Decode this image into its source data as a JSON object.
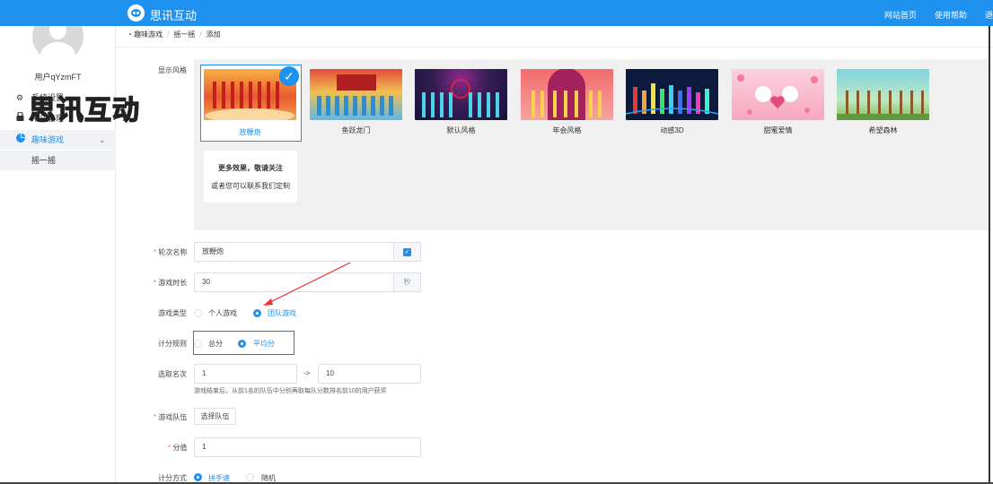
{
  "header": {
    "brand": "思讯互动",
    "nav": [
      "网站首页",
      "使用帮助",
      "退"
    ]
  },
  "sidebar": {
    "username": "用户qYzmFT",
    "items": [
      {
        "icon": "gear-icon",
        "label": "系统设置"
      },
      {
        "icon": "lock-icon",
        "label": "用户管理"
      },
      {
        "icon": "pie-chart-icon",
        "label": "趣味游戏"
      }
    ],
    "sub_items": [
      "摇一摇"
    ],
    "watermark": "思讯互动"
  },
  "breadcrumb": [
    "趣味游戏",
    "摇一摇",
    "添加"
  ],
  "form": {
    "style_label": "显示风格",
    "styles": [
      "放鞭炮",
      "鱼跃龙门",
      "默认风格",
      "年会风格",
      "动感3D",
      "甜蜜爱情",
      "希望森林"
    ],
    "selected_style": "放鞭炮",
    "more_title": "更多效果，敬请关注",
    "more_sub": "或者您可以联系我们定制",
    "round_name": {
      "label": "轮次名称",
      "value": "放鞭炮"
    },
    "duration": {
      "label": "游戏时长",
      "value": "30",
      "unit": "秒"
    },
    "game_type": {
      "label": "游戏类型",
      "options": [
        "个人游戏",
        "团队游戏"
      ],
      "selected": "团队游戏"
    },
    "score_rule": {
      "label": "计分规则",
      "options": [
        "总分",
        "平均分"
      ],
      "selected": "平均分"
    },
    "ranking": {
      "label": "选取名次",
      "from": "1",
      "arrow": "->",
      "to": "10",
      "hint": "游戏结束后，从前1名的队伍中分别再取每队分数排名前10的用户获奖"
    },
    "team": {
      "label": "游戏队伍",
      "button": "选择队伍"
    },
    "score_value": {
      "label": "分值",
      "value": "1"
    },
    "scoring_method": {
      "label": "计分方式",
      "options": [
        "拼手速",
        "随机"
      ],
      "selected": "拼手速"
    }
  },
  "colors": {
    "primary": "#1e92ee",
    "required": "#f56c6c",
    "highlight": "#e33333"
  }
}
